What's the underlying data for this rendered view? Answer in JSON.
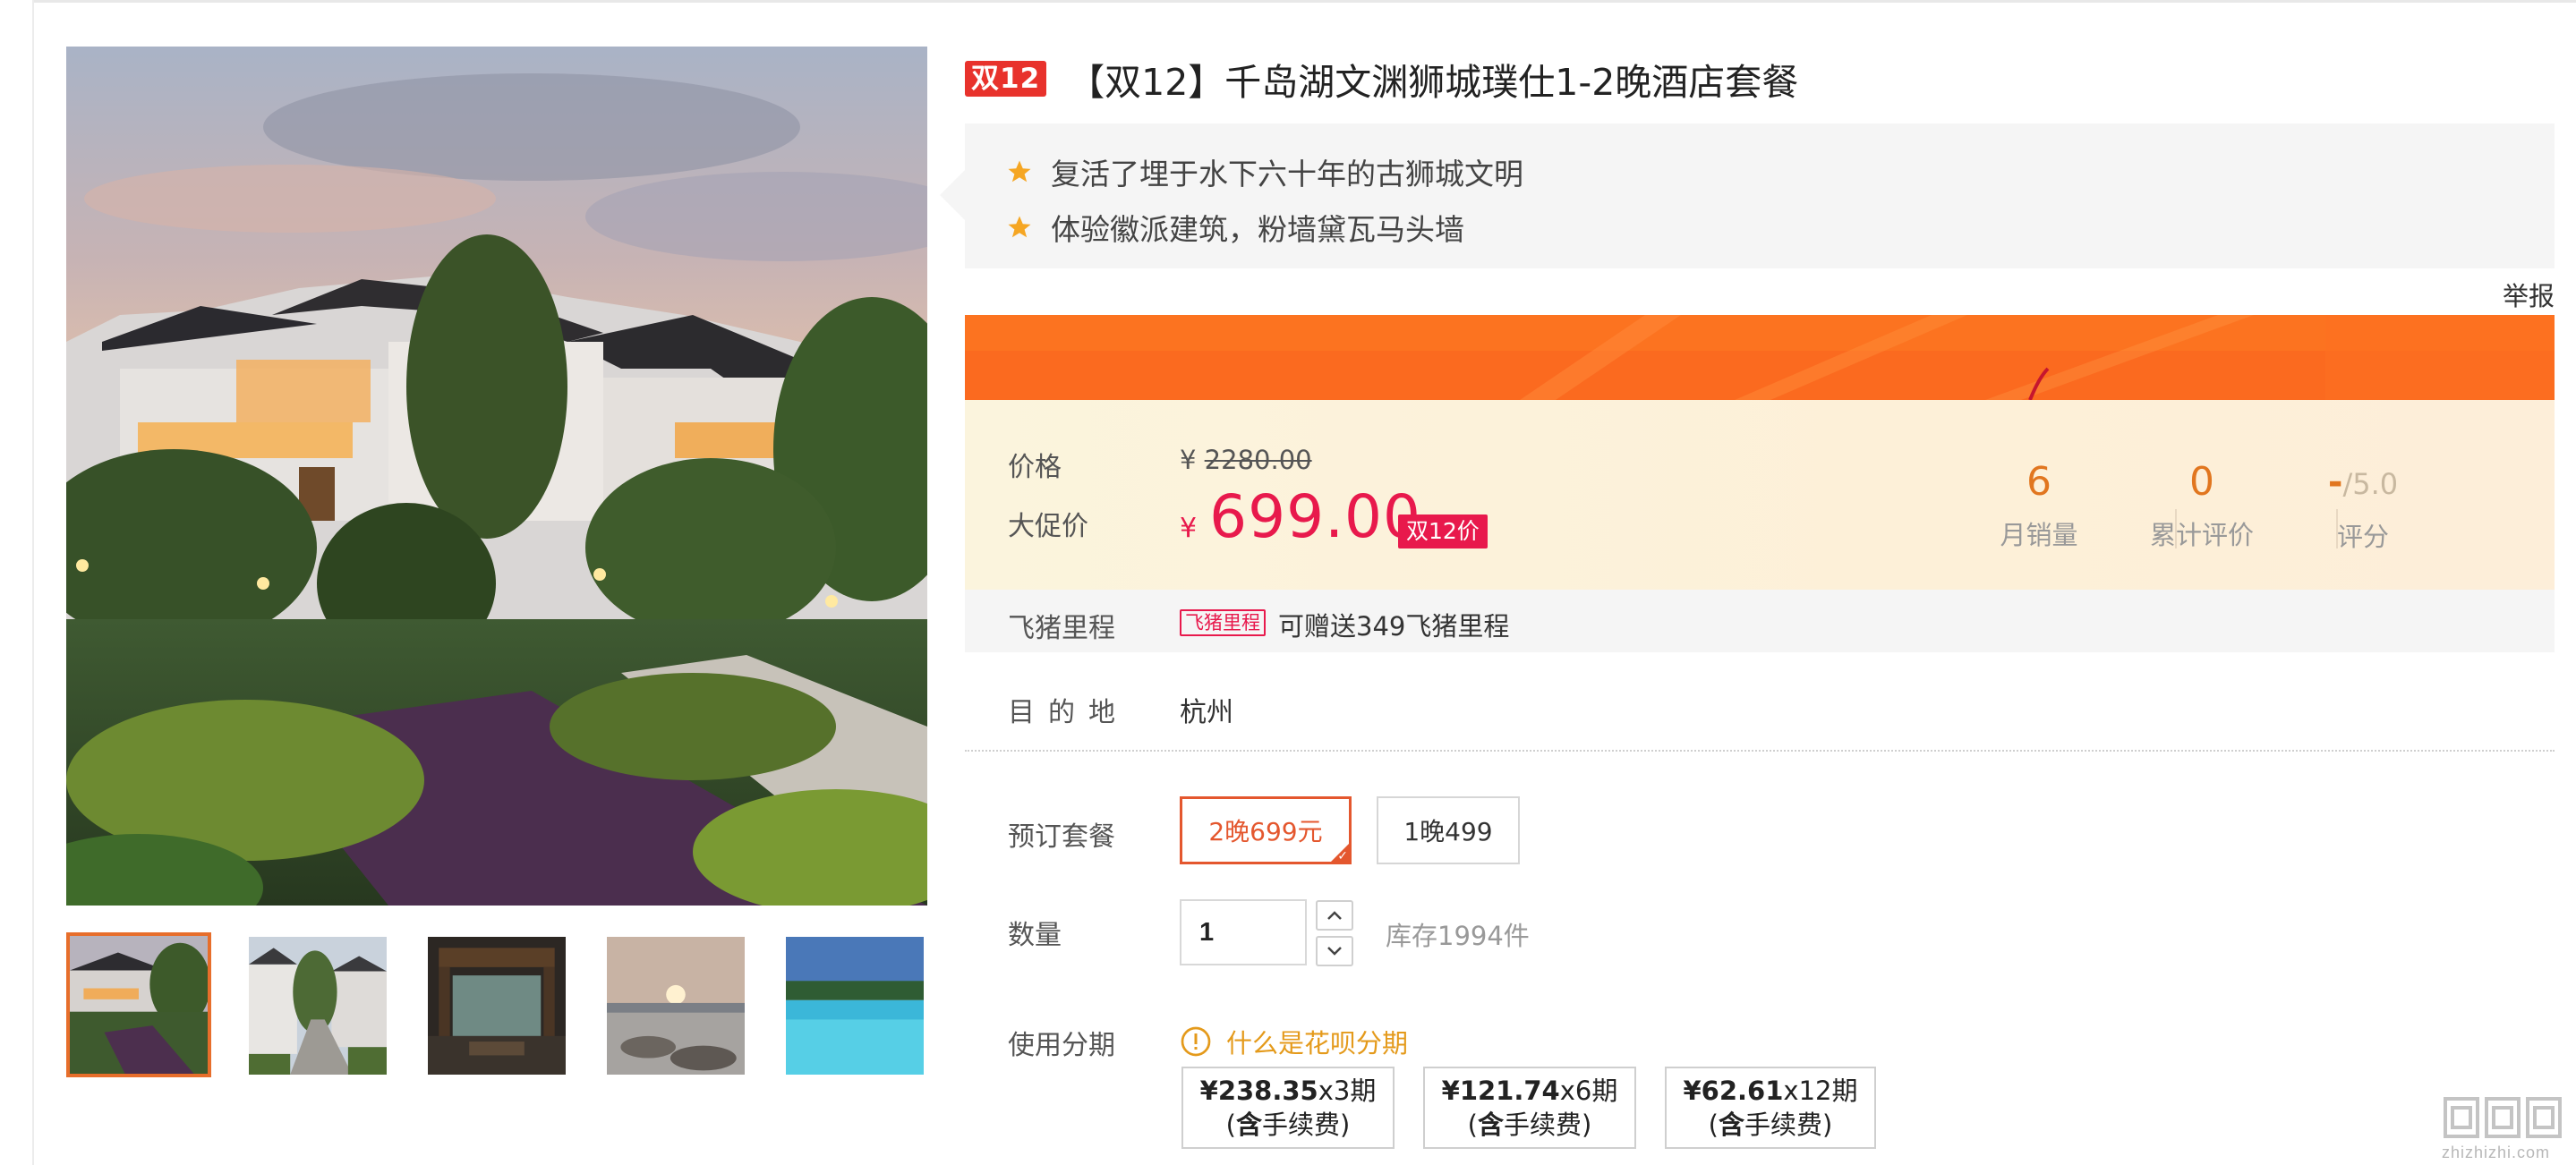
{
  "product": {
    "badge": "双12",
    "title": "【双12】千岛湖文渊狮城璞仕1-2晚酒店套餐",
    "highlights": [
      "复活了埋于水下六十年的古狮城文明",
      "体验徽派建筑，粉墙黛瓦马头墙"
    ],
    "report_label": "举报"
  },
  "pricing": {
    "price_label": "价格",
    "original_currency": "¥",
    "original_price": "2280.00",
    "promo_label": "大促价",
    "promo_currency": "¥",
    "promo_price": "699.00",
    "promo_tag": "双12价"
  },
  "stats": [
    {
      "value": "6",
      "label": "月销量"
    },
    {
      "value": "0",
      "label": "累计评价"
    },
    {
      "value_dash": "-",
      "value_suffix": "/5.0",
      "label": "评分"
    }
  ],
  "miles": {
    "label": "飞猪里程",
    "tag": "飞猪里程",
    "text": "可赠送349飞猪里程"
  },
  "destination": {
    "label": "目的地",
    "value": "杭州"
  },
  "packages": {
    "label": "预订套餐",
    "options": [
      "2晚699元",
      "1晚499"
    ],
    "selected_index": 0
  },
  "quantity": {
    "label": "数量",
    "value": "1",
    "stock": "库存1994件"
  },
  "installments": {
    "label": "使用分期",
    "help_link": "什么是花呗分期",
    "options": [
      {
        "amount": "¥238.35",
        "periods": "x3期",
        "fee_bold": "含",
        "fee_rest": "手续费"
      },
      {
        "amount": "¥121.74",
        "periods": "x6期",
        "fee_bold": "含",
        "fee_rest": "手续费"
      },
      {
        "amount": "¥62.61",
        "periods": "x12期",
        "fee_bold": "含",
        "fee_rest": "手续费"
      }
    ]
  },
  "gallery": {
    "thumbnail_count": 5,
    "active_index": 0
  },
  "watermark": {
    "url": "zhizhizhi.com"
  },
  "colors": {
    "accent_red": "#e8194c",
    "badge_red": "#e8322c",
    "orange": "#e4572e",
    "stat_orange": "#e1761f",
    "star_yellow": "#f5a623",
    "help_yellow": "#e49a1b"
  }
}
